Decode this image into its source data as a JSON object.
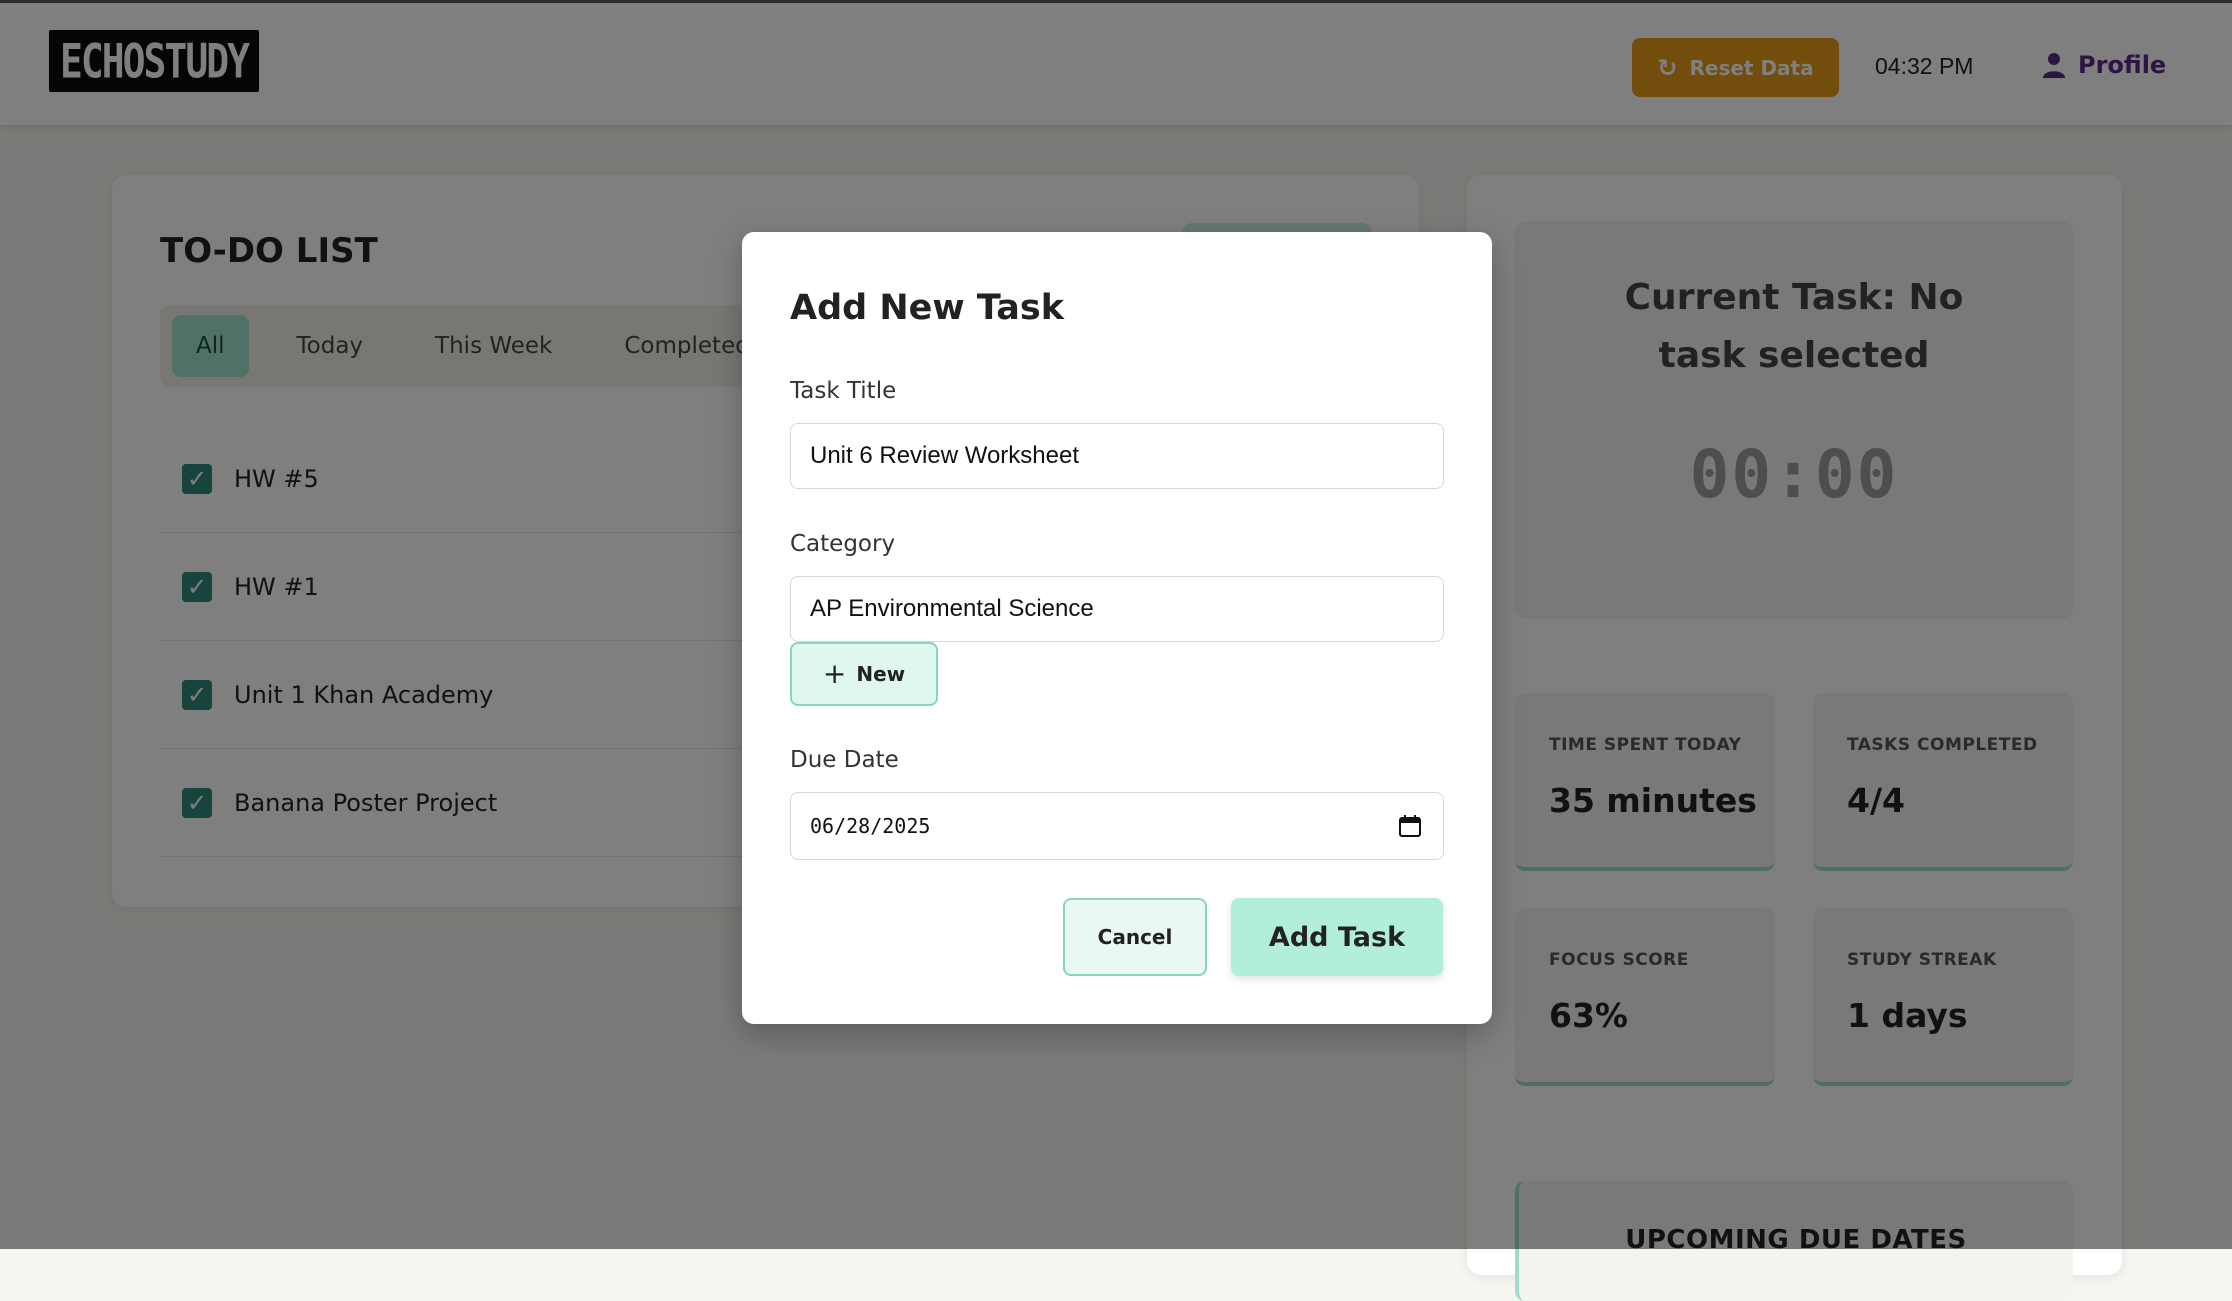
{
  "header": {
    "logo_text": "ECHOSTUDY",
    "reset_label": "Reset Data",
    "time": "04:32 PM",
    "profile_label": "Profile"
  },
  "todo": {
    "title": "TO-DO LIST",
    "tabs": [
      {
        "label": "All",
        "active": true
      },
      {
        "label": "Today",
        "active": false
      },
      {
        "label": "This Week",
        "active": false
      },
      {
        "label": "Completed",
        "active": false
      }
    ],
    "tasks": [
      {
        "label": "HW #5",
        "completed": true
      },
      {
        "label": "HW #1",
        "completed": true
      },
      {
        "label": "Unit 1 Khan Academy",
        "completed": true
      },
      {
        "label": "Banana Poster Project",
        "completed": true
      }
    ]
  },
  "timer": {
    "title": "Current Task: No task selected",
    "value": "00:00"
  },
  "stats": [
    {
      "label": "TIME SPENT TODAY",
      "value": "35 minutes"
    },
    {
      "label": "TASKS COMPLETED",
      "value": "4/4"
    },
    {
      "label": "FOCUS SCORE",
      "value": "63%"
    },
    {
      "label": "STUDY STREAK",
      "value": "1 days"
    }
  ],
  "upcoming": {
    "title": "UPCOMING DUE DATES"
  },
  "modal": {
    "title": "Add New Task",
    "task_title_label": "Task Title",
    "task_title_value": "Unit 6 Review Worksheet",
    "category_label": "Category",
    "category_value": "AP Environmental Science",
    "new_label": "New",
    "due_date_label": "Due Date",
    "due_date_value": "06/28/2025",
    "cancel_label": "Cancel",
    "add_label": "Add Task"
  },
  "colors": {
    "accent": "#9fe3cf",
    "reset": "#e49a16",
    "profile": "#5b2a86",
    "check": "#2e8b7a"
  }
}
